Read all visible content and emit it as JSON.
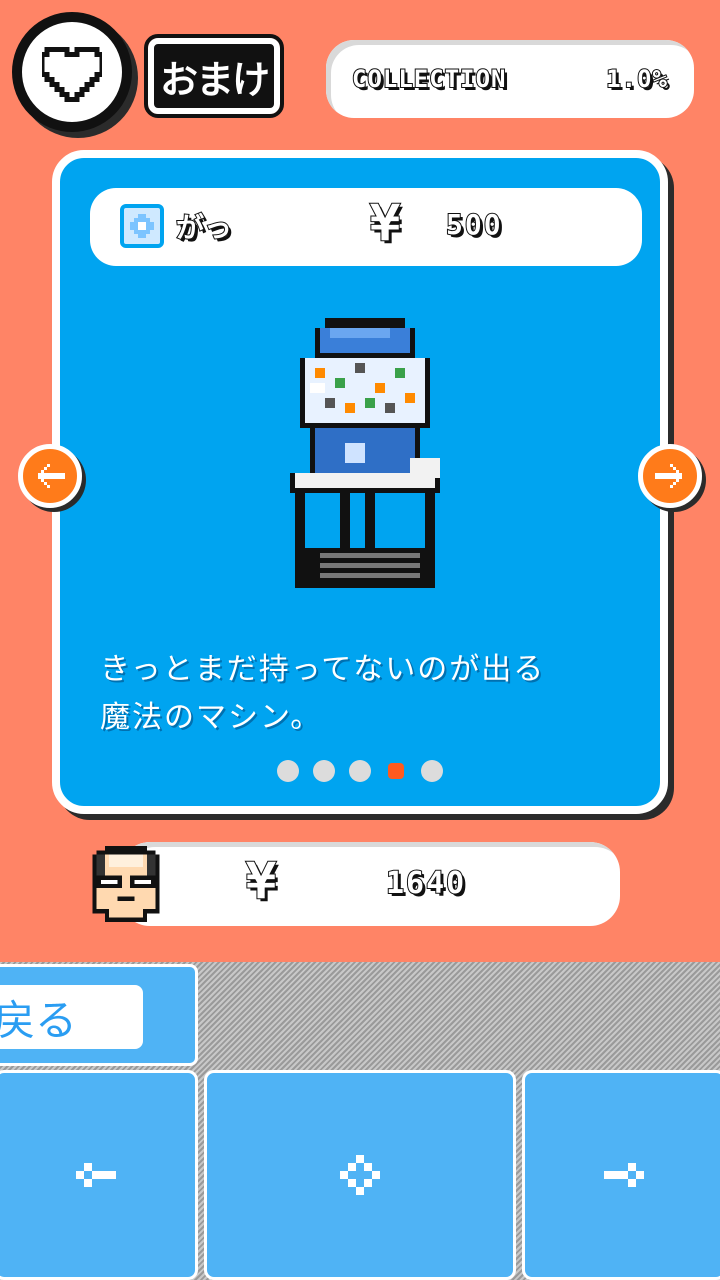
{
  "header": {
    "badge_icon": "heart-icon",
    "title": "おまけ",
    "collection_label": "COLLECTION",
    "collection_value": "1.0%"
  },
  "item": {
    "icon": "capsule-icon",
    "label": "がっ",
    "currency": "¥",
    "price": "500",
    "description": "きっとまだ持ってないのが出る\n魔法のマシン。",
    "page_count": 5,
    "active_page": 4
  },
  "wallet": {
    "avatar": "bald-glasses-man-avatar",
    "currency": "¥",
    "amount": "1640"
  },
  "controls": {
    "back_label": "戻る",
    "left_icon": "arrow-left-icon",
    "center_icon": "diamond-icon",
    "right_icon": "arrow-right-icon"
  },
  "colors": {
    "background": "#ff8466",
    "card": "#00a4f0",
    "accent": "#ff7b1a",
    "control": "#4fb3f5"
  }
}
